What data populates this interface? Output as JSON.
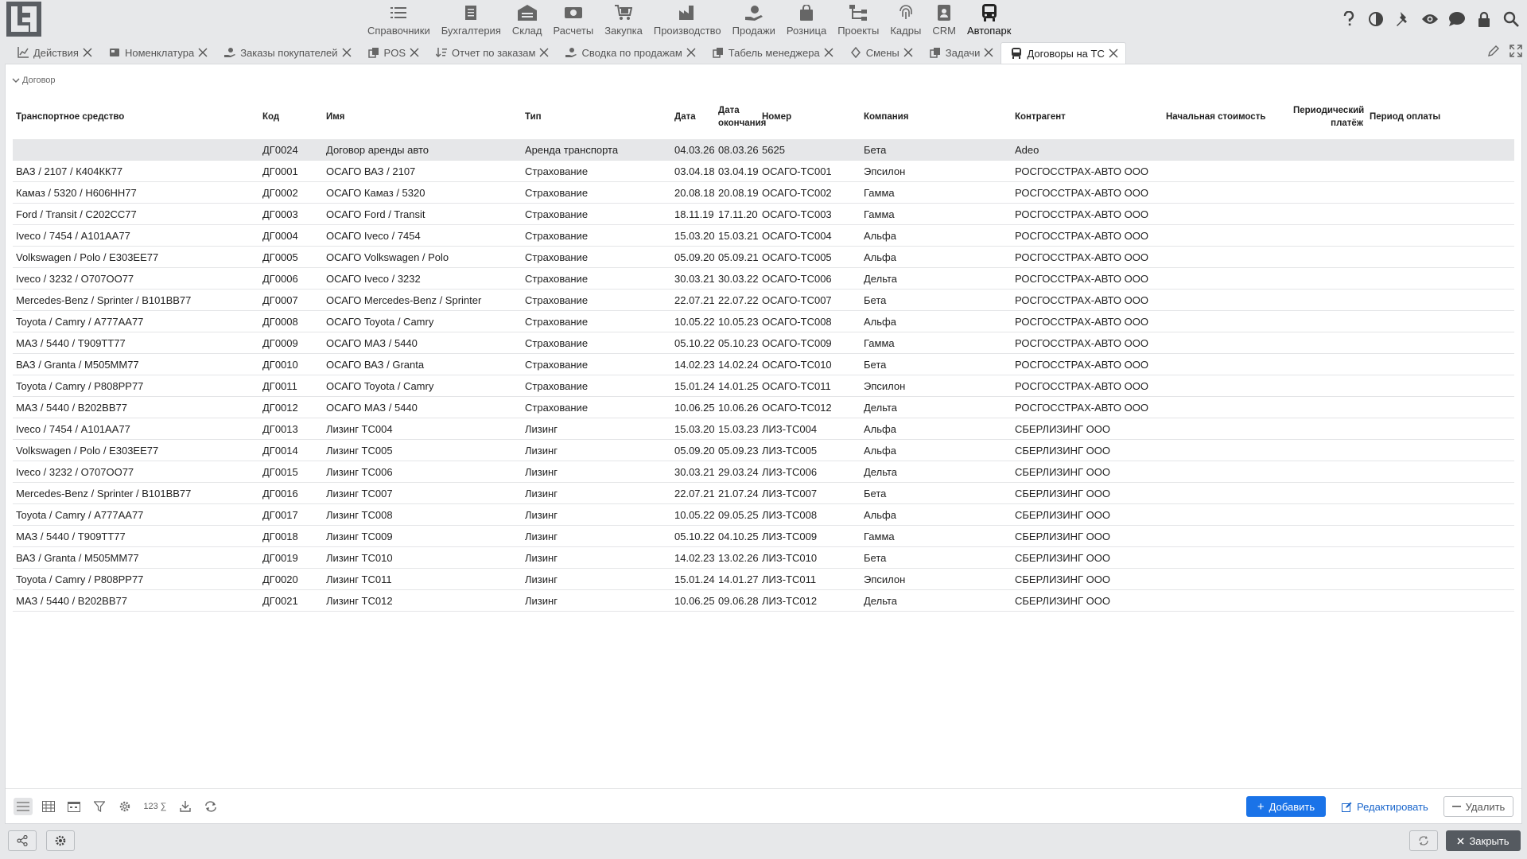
{
  "menu": [
    {
      "label": "Справочники",
      "icon": "list-icon"
    },
    {
      "label": "Бухгалтерия",
      "icon": "ledger-icon"
    },
    {
      "label": "Склад",
      "icon": "warehouse-icon"
    },
    {
      "label": "Расчеты",
      "icon": "money-icon"
    },
    {
      "label": "Закупка",
      "icon": "cart-icon"
    },
    {
      "label": "Производство",
      "icon": "factory-icon"
    },
    {
      "label": "Продажи",
      "icon": "sales-icon"
    },
    {
      "label": "Розница",
      "icon": "bag-icon"
    },
    {
      "label": "Проекты",
      "icon": "hierarchy-icon"
    },
    {
      "label": "Кадры",
      "icon": "fingerprint-icon"
    },
    {
      "label": "CRM",
      "icon": "contact-card-icon"
    },
    {
      "label": "Автопарк",
      "icon": "bus-icon"
    }
  ],
  "tabs": [
    {
      "label": "Действия"
    },
    {
      "label": "Номенклатура"
    },
    {
      "label": "Заказы покупателей"
    },
    {
      "label": "POS"
    },
    {
      "label": "Отчет по заказам"
    },
    {
      "label": "Сводка по продажам"
    },
    {
      "label": "Табель менеджера"
    },
    {
      "label": "Смены"
    },
    {
      "label": "Задачи"
    },
    {
      "label": "Договоры на ТС"
    }
  ],
  "section": {
    "title": "Договор"
  },
  "columns": [
    "Транспортное средство",
    "Код",
    "Имя",
    "Тип",
    "Дата",
    "Дата окончания",
    "Номер",
    "Компания",
    "Контрагент",
    "Начальная стоимость",
    "Периодический платёж",
    "Период оплаты"
  ],
  "rows": [
    [
      "",
      "ДГ0024",
      "Договор аренды авто",
      "Аренда транспорта",
      "04.03.26",
      "08.03.26",
      "5625",
      "Бета",
      "Adeo",
      "",
      "",
      ""
    ],
    [
      "ВАЗ / 2107 / К404КК77",
      "ДГ0001",
      "ОСАГО ВАЗ / 2107",
      "Страхование",
      "03.04.18",
      "03.04.19",
      "ОСАГО-ТС001",
      "Эпсилон",
      "РОСГОССТРАХ-АВТО ООО",
      "",
      "",
      ""
    ],
    [
      "Камаз / 5320 / Н606НН77",
      "ДГ0002",
      "ОСАГО Камаз / 5320",
      "Страхование",
      "20.08.18",
      "20.08.19",
      "ОСАГО-ТС002",
      "Гамма",
      "РОСГОССТРАХ-АВТО ООО",
      "",
      "",
      ""
    ],
    [
      "Ford / Transit / С202СС77",
      "ДГ0003",
      "ОСАГО Ford / Transit",
      "Страхование",
      "18.11.19",
      "17.11.20",
      "ОСАГО-ТС003",
      "Гамма",
      "РОСГОССТРАХ-АВТО ООО",
      "",
      "",
      ""
    ],
    [
      "Iveco / 7454 / А101АА77",
      "ДГ0004",
      "ОСАГО Iveco / 7454",
      "Страхование",
      "15.03.20",
      "15.03.21",
      "ОСАГО-ТС004",
      "Альфа",
      "РОСГОССТРАХ-АВТО ООО",
      "",
      "",
      ""
    ],
    [
      "Volkswagen / Polo / Е303ЕЕ77",
      "ДГ0005",
      "ОСАГО Volkswagen / Polo",
      "Страхование",
      "05.09.20",
      "05.09.21",
      "ОСАГО-ТС005",
      "Альфа",
      "РОСГОССТРАХ-АВТО ООО",
      "",
      "",
      ""
    ],
    [
      "Iveco / 3232 / О707ОО77",
      "ДГ0006",
      "ОСАГО Iveco / 3232",
      "Страхование",
      "30.03.21",
      "30.03.22",
      "ОСАГО-ТС006",
      "Дельта",
      "РОСГОССТРАХ-АВТО ООО",
      "",
      "",
      ""
    ],
    [
      "Mercedes-Benz / Sprinter / В101ВВ77",
      "ДГ0007",
      "ОСАГО Mercedes-Benz / Sprinter",
      "Страхование",
      "22.07.21",
      "22.07.22",
      "ОСАГО-ТС007",
      "Бета",
      "РОСГОССТРАХ-АВТО ООО",
      "",
      "",
      ""
    ],
    [
      "Toyota / Camry / А777АА77",
      "ДГ0008",
      "ОСАГО Toyota / Camry",
      "Страхование",
      "10.05.22",
      "10.05.23",
      "ОСАГО-ТС008",
      "Альфа",
      "РОСГОССТРАХ-АВТО ООО",
      "",
      "",
      ""
    ],
    [
      "МАЗ / 5440 / Т909ТТ77",
      "ДГ0009",
      "ОСАГО МАЗ / 5440",
      "Страхование",
      "05.10.22",
      "05.10.23",
      "ОСАГО-ТС009",
      "Гамма",
      "РОСГОССТРАХ-АВТО ООО",
      "",
      "",
      ""
    ],
    [
      "ВАЗ / Granta / М505ММ77",
      "ДГ0010",
      "ОСАГО ВАЗ / Granta",
      "Страхование",
      "14.02.23",
      "14.02.24",
      "ОСАГО-ТС010",
      "Бета",
      "РОСГОССТРАХ-АВТО ООО",
      "",
      "",
      ""
    ],
    [
      "Toyota / Camry / Р808РР77",
      "ДГ0011",
      "ОСАГО Toyota / Camry",
      "Страхование",
      "15.01.24",
      "14.01.25",
      "ОСАГО-ТС011",
      "Эпсилон",
      "РОСГОССТРАХ-АВТО ООО",
      "",
      "",
      ""
    ],
    [
      "МАЗ / 5440 / В202ВВ77",
      "ДГ0012",
      "ОСАГО МАЗ / 5440",
      "Страхование",
      "10.06.25",
      "10.06.26",
      "ОСАГО-ТС012",
      "Дельта",
      "РОСГОССТРАХ-АВТО ООО",
      "",
      "",
      ""
    ],
    [
      "Iveco / 7454 / А101АА77",
      "ДГ0013",
      "Лизинг ТС004",
      "Лизинг",
      "15.03.20",
      "15.03.23",
      "ЛИЗ-ТС004",
      "Альфа",
      "СБЕРЛИЗИНГ ООО",
      "",
      "",
      ""
    ],
    [
      "Volkswagen / Polo / Е303ЕЕ77",
      "ДГ0014",
      "Лизинг ТС005",
      "Лизинг",
      "05.09.20",
      "05.09.23",
      "ЛИЗ-ТС005",
      "Альфа",
      "СБЕРЛИЗИНГ ООО",
      "",
      "",
      ""
    ],
    [
      "Iveco / 3232 / О707ОО77",
      "ДГ0015",
      "Лизинг ТС006",
      "Лизинг",
      "30.03.21",
      "29.03.24",
      "ЛИЗ-ТС006",
      "Дельта",
      "СБЕРЛИЗИНГ ООО",
      "",
      "",
      ""
    ],
    [
      "Mercedes-Benz / Sprinter / В101ВВ77",
      "ДГ0016",
      "Лизинг ТС007",
      "Лизинг",
      "22.07.21",
      "21.07.24",
      "ЛИЗ-ТС007",
      "Бета",
      "СБЕРЛИЗИНГ ООО",
      "",
      "",
      ""
    ],
    [
      "Toyota / Camry / А777АА77",
      "ДГ0017",
      "Лизинг ТС008",
      "Лизинг",
      "10.05.22",
      "09.05.25",
      "ЛИЗ-ТС008",
      "Альфа",
      "СБЕРЛИЗИНГ ООО",
      "",
      "",
      ""
    ],
    [
      "МАЗ / 5440 / Т909ТТ77",
      "ДГ0018",
      "Лизинг ТС009",
      "Лизинг",
      "05.10.22",
      "04.10.25",
      "ЛИЗ-ТС009",
      "Гамма",
      "СБЕРЛИЗИНГ ООО",
      "",
      "",
      ""
    ],
    [
      "ВАЗ / Granta / М505ММ77",
      "ДГ0019",
      "Лизинг ТС010",
      "Лизинг",
      "14.02.23",
      "13.02.26",
      "ЛИЗ-ТС010",
      "Бета",
      "СБЕРЛИЗИНГ ООО",
      "",
      "",
      ""
    ],
    [
      "Toyota / Camry / Р808РР77",
      "ДГ0020",
      "Лизинг ТС011",
      "Лизинг",
      "15.01.24",
      "14.01.27",
      "ЛИЗ-ТС011",
      "Эпсилон",
      "СБЕРЛИЗИНГ ООО",
      "",
      "",
      ""
    ],
    [
      "МАЗ / 5440 / В202ВВ77",
      "ДГ0021",
      "Лизинг ТС012",
      "Лизинг",
      "10.06.25",
      "09.06.28",
      "ЛИЗ-ТС012",
      "Дельта",
      "СБЕРЛИЗИНГ ООО",
      "",
      "",
      ""
    ]
  ],
  "toolbar": {
    "sum_label": "123 ∑"
  },
  "actions": {
    "add": "Добавить",
    "edit": "Редактировать",
    "delete": "Удалить"
  },
  "footer": {
    "close": "Закрыть"
  },
  "colors": {
    "accent": "#1a73e8",
    "selected_row": "#e6e7e9",
    "close_button": "#555a60"
  }
}
